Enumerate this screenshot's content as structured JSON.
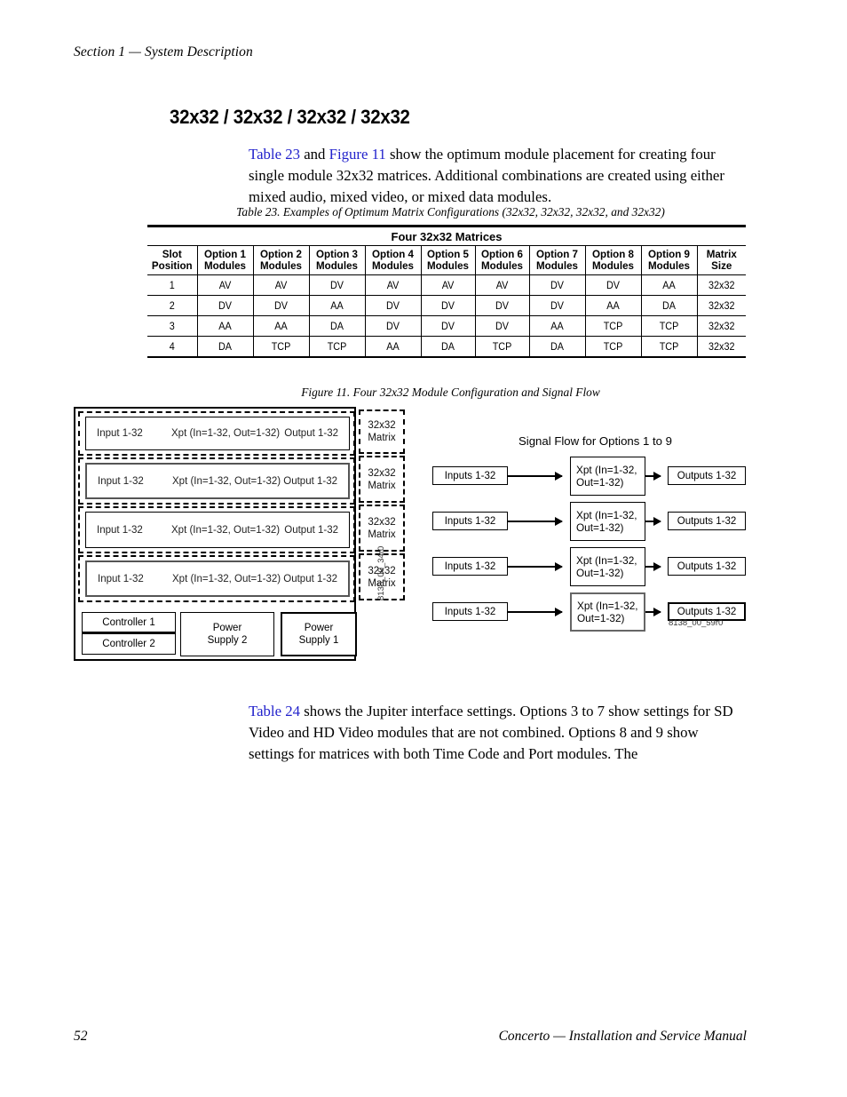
{
  "running_head": "Section 1 — System Description",
  "section_heading": "32x32 / 32x32 / 32x32 / 32x32",
  "intro_paragraph": {
    "xref1": "Table 23",
    "mid": " and ",
    "xref2": "Figure 11",
    "rest": " show the optimum module placement for creating four single module 32x32 matrices. Additional combinations are created using either mixed audio, mixed video, or mixed data modules."
  },
  "table": {
    "caption": "Table 23.  Examples of Optimum Matrix Configurations (32x32, 32x32, 32x32, and 32x32)",
    "group_header": "Four 32x32 Matrices",
    "columns": [
      "Slot\nPosition",
      "Option 1\nModules",
      "Option 2\nModules",
      "Option 3\nModules",
      "Option 4\nModules",
      "Option 5\nModules",
      "Option 6\nModules",
      "Option 7\nModules",
      "Option 8\nModules",
      "Option 9\nModules",
      "Matrix\nSize"
    ],
    "columns_line1": [
      "Slot",
      "Option 1",
      "Option 2",
      "Option 3",
      "Option 4",
      "Option 5",
      "Option 6",
      "Option 7",
      "Option 8",
      "Option 9",
      "Matrix"
    ],
    "columns_line2": [
      "Position",
      "Modules",
      "Modules",
      "Modules",
      "Modules",
      "Modules",
      "Modules",
      "Modules",
      "Modules",
      "Modules",
      "Size"
    ],
    "rows": [
      [
        "1",
        "AV",
        "AV",
        "DV",
        "AV",
        "AV",
        "AV",
        "DV",
        "DV",
        "AA",
        "32x32"
      ],
      [
        "2",
        "DV",
        "DV",
        "AA",
        "DV",
        "DV",
        "DV",
        "DV",
        "AA",
        "DA",
        "32x32"
      ],
      [
        "3",
        "AA",
        "AA",
        "DA",
        "DV",
        "DV",
        "DV",
        "AA",
        "TCP",
        "TCP",
        "32x32"
      ],
      [
        "4",
        "DA",
        "TCP",
        "TCP",
        "AA",
        "DA",
        "TCP",
        "DA",
        "TCP",
        "TCP",
        "32x32"
      ]
    ]
  },
  "figure": {
    "caption": "Figure 11.  Four 32x32 Module Configuration and Signal Flow",
    "chassis": {
      "id_label": "8138_00_34r0",
      "slots": [
        {
          "input": "Input 1-32",
          "xpt": "Xpt (In=1-32, Out=1-32)",
          "output": "Output 1-32",
          "matrix_tag_line1": "32x32",
          "matrix_tag_line2": "Matrix",
          "emphasis": false
        },
        {
          "input": "Input 1-32",
          "xpt": "Xpt (In=1-32, Out=1-32)",
          "output": "Output 1-32",
          "matrix_tag_line1": "32x32",
          "matrix_tag_line2": "Matrix",
          "emphasis": true
        },
        {
          "input": "Input 1-32",
          "xpt": "Xpt (In=1-32, Out=1-32)",
          "output": "Output 1-32",
          "matrix_tag_line1": "32x32",
          "matrix_tag_line2": "Matrix",
          "emphasis": false
        },
        {
          "input": "Input 1-32",
          "xpt": "Xpt (In=1-32, Out=1-32)",
          "output": "Output 1-32",
          "matrix_tag_line1": "32x32",
          "matrix_tag_line2": "Matrix",
          "emphasis": true
        }
      ],
      "controller_1": "Controller 1",
      "controller_2": "Controller 2",
      "power_supply_2_line1": "Power",
      "power_supply_2_line2": "Supply 2",
      "power_supply_1_line1": "Power",
      "power_supply_1_line2": "Supply 1"
    },
    "signal_flow": {
      "title": "Signal Flow for Options 1 to 9",
      "id_label": "8138_00_59r0",
      "rows": [
        {
          "input": "Inputs 1-32",
          "xpt_line1": "Xpt (In=1-32,",
          "xpt_line2": "Out=1-32)",
          "output": "Outputs 1-32",
          "emphasis": false
        },
        {
          "input": "Inputs 1-32",
          "xpt_line1": "Xpt (In=1-32,",
          "xpt_line2": "Out=1-32)",
          "output": "Outputs 1-32",
          "emphasis": false
        },
        {
          "input": "Inputs 1-32",
          "xpt_line1": "Xpt (In=1-32,",
          "xpt_line2": "Out=1-32)",
          "output": "Outputs 1-32",
          "emphasis": false
        },
        {
          "input": "Inputs 1-32",
          "xpt_line1": "Xpt (In=1-32,",
          "xpt_line2": "Out=1-32)",
          "output": "Outputs 1-32",
          "emphasis": true
        }
      ]
    }
  },
  "outro_paragraph": {
    "xref1": "Table 24",
    "rest": " shows the Jupiter interface settings. Options 3 to 7 show settings for SD Video and HD Video modules that are not combined. Options 8 and 9 show settings for matrices with both Time Code and Port modules. The"
  },
  "footer": {
    "page_number": "52",
    "title": "Concerto  —  Installation and Service Manual"
  },
  "colors": {
    "xref": "#2222cc",
    "text": "#000000",
    "page_bg": "#ffffff"
  }
}
